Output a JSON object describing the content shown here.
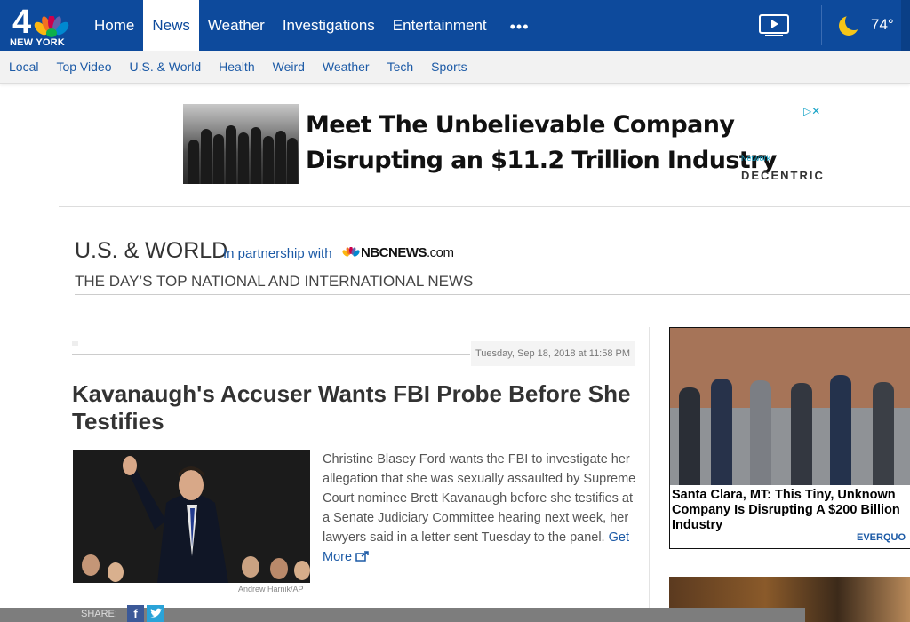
{
  "brand": {
    "logo_number": "4",
    "logo_city": "NEW YORK"
  },
  "nav": {
    "items": [
      {
        "label": "Home",
        "active": false
      },
      {
        "label": "News",
        "active": true
      },
      {
        "label": "Weather",
        "active": false
      },
      {
        "label": "Investigations",
        "active": false
      },
      {
        "label": "Entertainment",
        "active": false
      }
    ],
    "more_label": "•••"
  },
  "weather": {
    "temperature": "74°",
    "icon": "moon-icon"
  },
  "subnav": {
    "items": [
      "Local",
      "Top Video",
      "U.S. & World",
      "Health",
      "Weird",
      "Weather",
      "Tech",
      "Sports"
    ]
  },
  "ad_banner": {
    "headline": "Meet The Unbelievable Company Disrupting an $11.2 Trillion Industry",
    "network_label": "Network",
    "brand": "DECENTRIC"
  },
  "section": {
    "title": "U.S. & WORLD",
    "partnership": "In partnership with",
    "partner_name": "NBCNEWS",
    "partner_suffix": ".com",
    "subtitle": "THE DAY’S TOP NATIONAL AND INTERNATIONAL NEWS"
  },
  "article": {
    "date": "Tuesday, Sep 18, 2018 at 11:58 PM",
    "headline": "Kavanaugh's Accuser Wants FBI Probe Before She Testifies",
    "summary": "Christine Blasey Ford wants the FBI to investigate her allegation that she was sexually assaulted by Supreme Court nominee Brett Kavanaugh before she testifies at a Senate Judiciary Committee hearing next week, her lawyers said in a letter sent Tuesday to the panel.",
    "get_more": "Get More",
    "photo_credit": "Andrew Harnik/AP",
    "share_label": "SHARE:"
  },
  "side_ad": {
    "headline": "Santa Clara, MT: This Tiny, Unknown Company Is Disrupting A $200 Billion Industry",
    "brand": "EVERQUO"
  },
  "colors": {
    "primary": "#0d4a9c",
    "link": "#1c5aa6"
  }
}
